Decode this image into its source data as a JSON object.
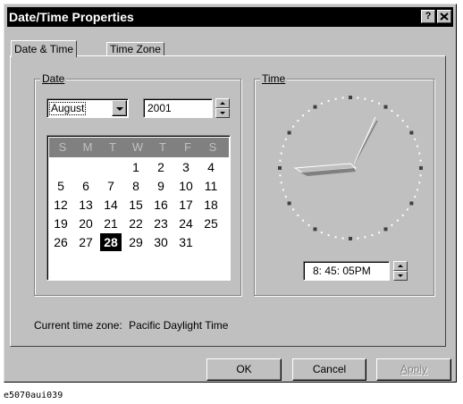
{
  "window": {
    "title": "Date/Time Properties",
    "help_button": "?",
    "close_button": "X"
  },
  "tabs": [
    {
      "label": "Date & Time",
      "active": true
    },
    {
      "label": "Time Zone",
      "active": false
    }
  ],
  "date_group": {
    "label": "Date",
    "month": "August",
    "year": "2001",
    "weekday_headers": [
      "S",
      "M",
      "T",
      "W",
      "T",
      "F",
      "S"
    ],
    "weeks": [
      [
        "",
        "",
        "",
        "1",
        "2",
        "3",
        "4"
      ],
      [
        "5",
        "6",
        "7",
        "8",
        "9",
        "10",
        "11"
      ],
      [
        "12",
        "13",
        "14",
        "15",
        "16",
        "17",
        "18"
      ],
      [
        "19",
        "20",
        "21",
        "22",
        "23",
        "24",
        "25"
      ],
      [
        "26",
        "27",
        "28",
        "29",
        "30",
        "31",
        ""
      ]
    ],
    "selected_day": "28"
  },
  "time_group": {
    "label": "Time",
    "time_value": "8: 45: 05PM"
  },
  "time_zone_label": "Current time zone:",
  "time_zone_value": "Pacific Daylight Time",
  "buttons": {
    "ok": "OK",
    "cancel": "Cancel",
    "apply": "Apply"
  },
  "caption": "e5070aui039",
  "colors": {
    "face": "#c0c0c0",
    "title_bar": "#000000",
    "calendar_header": "#808080"
  }
}
